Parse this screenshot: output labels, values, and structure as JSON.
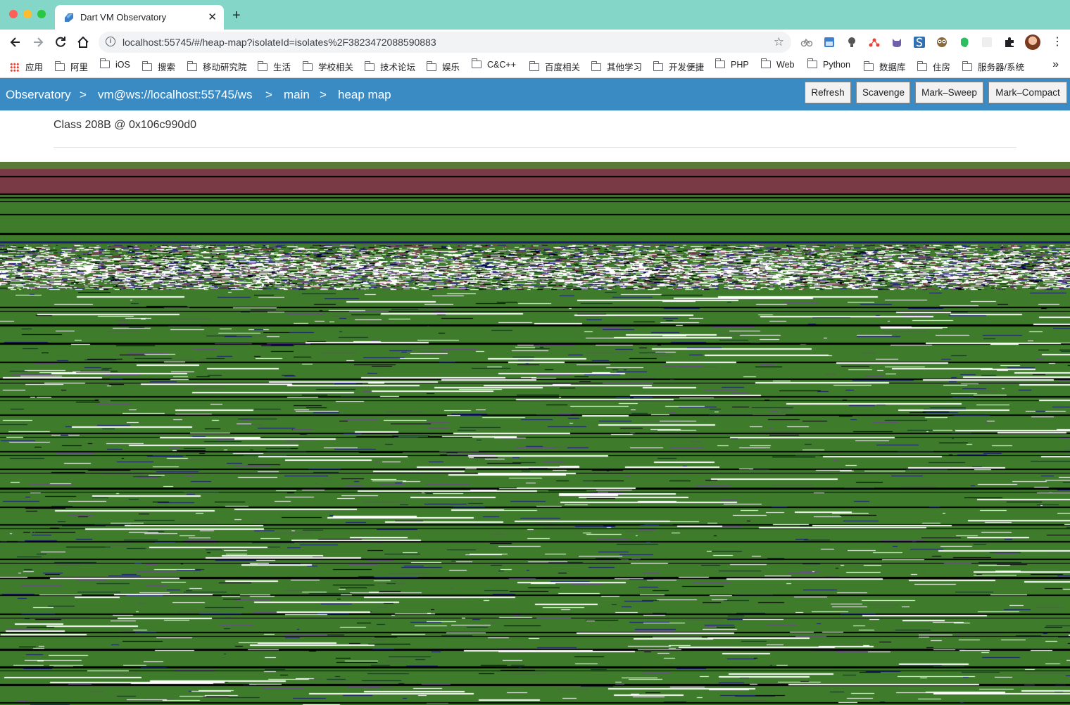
{
  "browser": {
    "tab_title": "Dart VM Observatory",
    "url": "localhost:55745/#/heap-map?isolateId=isolates%2F3823472088590883",
    "bookmarks": [
      "应用",
      "阿里",
      "iOS",
      "搜索",
      "移动研究院",
      "生活",
      "学校相关",
      "技术论坛",
      "娱乐",
      "C&C++",
      "百度相关",
      "其他学习",
      "开发便捷",
      "PHP",
      "Web",
      "Python",
      "数据库",
      "住房",
      "服务器/系统"
    ],
    "bookmarks_overflow": "»"
  },
  "observatory": {
    "breadcrumbs": [
      "Observatory",
      "vm@ws://localhost:55745/ws",
      "main",
      "heap map"
    ],
    "separator": ">",
    "buttons": [
      "Refresh",
      "Scavenge",
      "Mark–Sweep",
      "Mark–Compact"
    ],
    "status": "Class 208B @ 0x106c990d0"
  },
  "colors": {
    "tab_strip": "#83d6c8",
    "nav_bar": "#3a8ac4",
    "heap_green": "#3e7b2b",
    "heap_olive": "#5a7a3a",
    "heap_maroon": "#7a3a45",
    "heap_black": "#000000",
    "heap_navy": "#1a1a7a",
    "heap_purple": "#6a4a8a",
    "heap_white": "#ffffff"
  }
}
